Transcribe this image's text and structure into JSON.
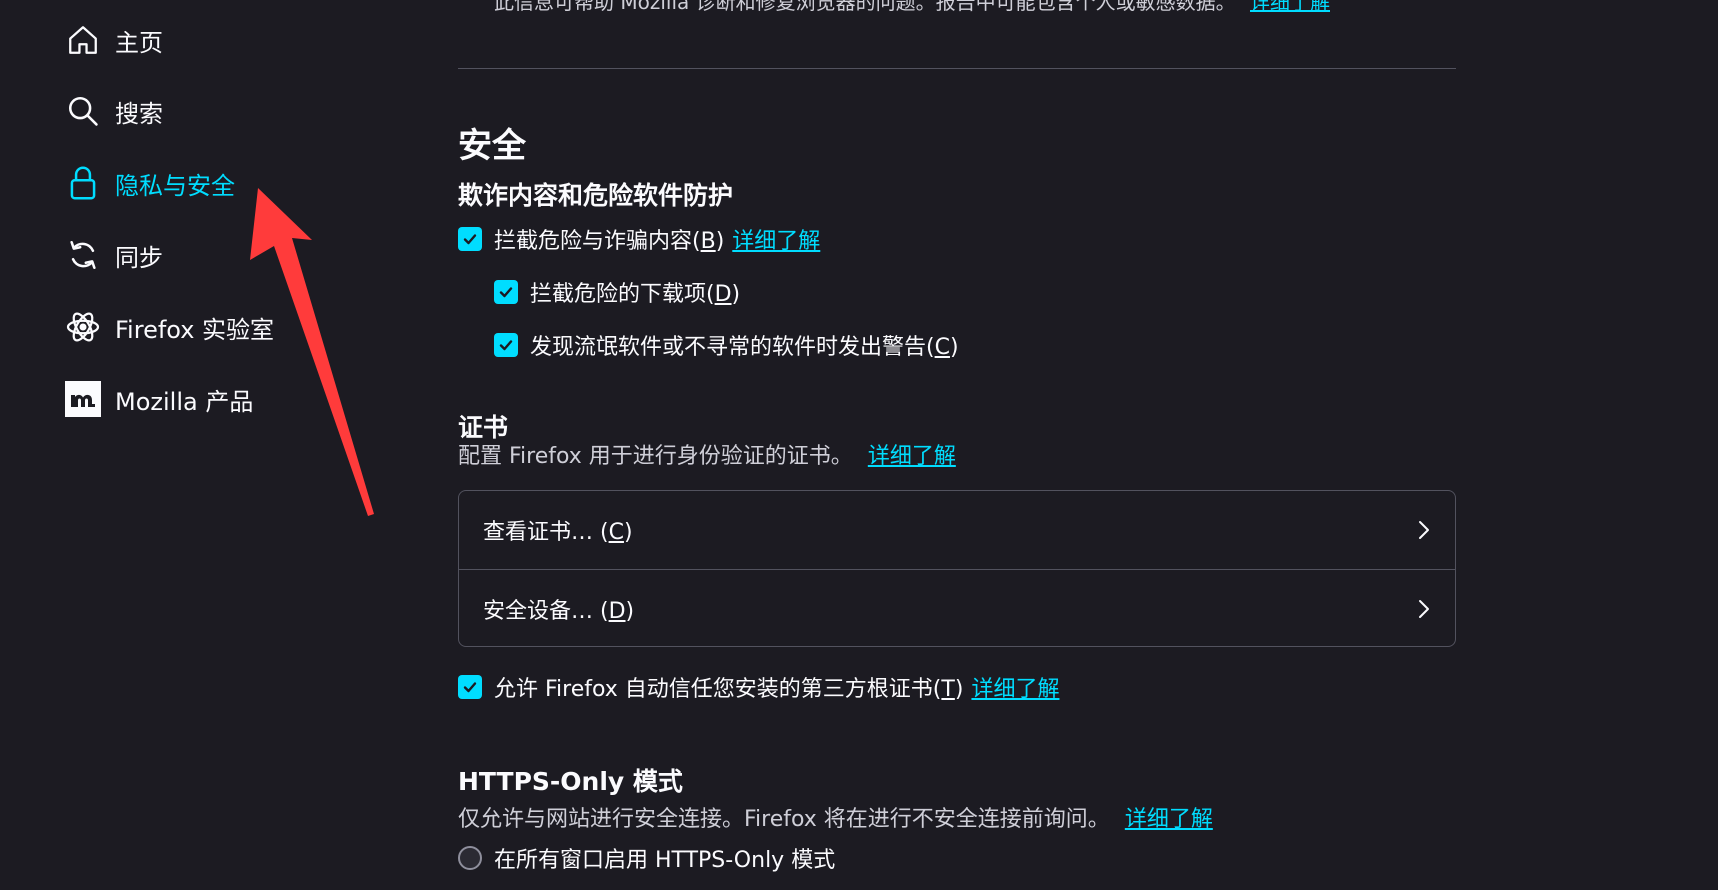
{
  "sidebar": {
    "items": [
      {
        "label": "主页",
        "icon": "home-icon"
      },
      {
        "label": "搜索",
        "icon": "search-icon"
      },
      {
        "label": "隐私与安全",
        "icon": "lock-icon",
        "active": true
      },
      {
        "label": "同步",
        "icon": "sync-icon"
      },
      {
        "label": "Firefox 实验室",
        "icon": "flask-atom-icon"
      },
      {
        "label": "Mozilla 产品",
        "icon": "mozilla-logo-icon"
      }
    ]
  },
  "intro": {
    "text": "此信息可帮助 Mozilla 诊断和修复浏览器的问题。报告中可能包含个人或敏感数据。",
    "link": "详细了解"
  },
  "security": {
    "title": "安全",
    "subtitle": "欺诈内容和危险软件防护",
    "block_deceptive": {
      "label_pre": "拦截危险与诈骗内容(",
      "key": "B",
      "label_post": ")",
      "link": "详细了解"
    },
    "block_downloads": {
      "label_pre": "拦截危险的下载项(",
      "key": "D",
      "label_post": ")"
    },
    "warn_unwanted": {
      "label_pre": "发现流氓软件或不寻常的软件时发出警告(",
      "key": "C",
      "label_post": ")"
    }
  },
  "certificates": {
    "title": "证书",
    "desc": "配置 Firefox 用于进行身份验证的证书。",
    "link": "详细了解",
    "view_button": {
      "label_pre": "查看证书… (",
      "key": "C",
      "label_post": ")"
    },
    "devices_button": {
      "label_pre": "安全设备… (",
      "key": "D",
      "label_post": ")"
    },
    "trust_third_party": {
      "label_pre": "允许 Firefox 自动信任您安装的第三方根证书(",
      "key": "T",
      "label_post": ")",
      "link": "详细了解"
    }
  },
  "https_only": {
    "title": "HTTPS-Only 模式",
    "desc": "仅允许与网站进行安全连接。Firefox 将在进行不安全连接前询问。",
    "link": "详细了解",
    "enable_all": "在所有窗口启用 HTTPS-Only 模式"
  },
  "colors": {
    "background": "#1c1b22",
    "accent": "#00ddff",
    "text": "#fbfbfe",
    "annotation_arrow": "#ff3b3b"
  }
}
